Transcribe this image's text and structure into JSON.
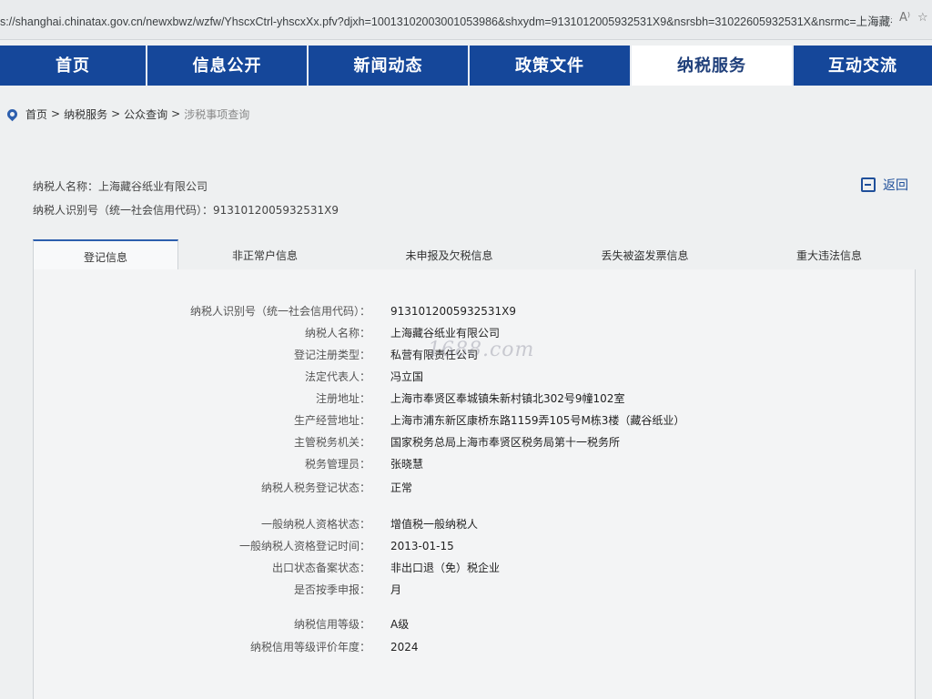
{
  "browser": {
    "url": "s://shanghai.chinatax.gov.cn/newxbwz/wzfw/YhscxCtrl-yhscxXx.pfv?djxh=10013102003001053986&shxydm=9131012005932531X9&nsrsbh=31022605932531X&nsrmc=上海藏谷纸..."
  },
  "nav": {
    "items": [
      {
        "label": "首页"
      },
      {
        "label": "信息公开"
      },
      {
        "label": "新闻动态"
      },
      {
        "label": "政策文件"
      },
      {
        "label": "纳税服务"
      },
      {
        "label": "互动交流"
      }
    ]
  },
  "breadcrumb": {
    "home": "首页",
    "level2": "纳税服务",
    "level3": "公众查询",
    "current": "涉税事项查询",
    "sep": ">"
  },
  "header": {
    "name_line": "纳税人名称：上海藏谷纸业有限公司",
    "id_line": "纳税人识别号（统一社会信用代码）：9131012005932531X9",
    "back_label": "返回"
  },
  "tabs": [
    {
      "label": "登记信息"
    },
    {
      "label": "非正常户信息"
    },
    {
      "label": "未申报及欠税信息"
    },
    {
      "label": "丢失被盗发票信息"
    },
    {
      "label": "重大违法信息"
    }
  ],
  "details": [
    {
      "label": "纳税人识别号（统一社会信用代码）：",
      "value": "9131012005932531X9"
    },
    {
      "label": "纳税人名称：",
      "value": "上海藏谷纸业有限公司"
    },
    {
      "label": "登记注册类型：",
      "value": "私营有限责任公司"
    },
    {
      "label": "法定代表人：",
      "value": "冯立国"
    },
    {
      "label": "注册地址：",
      "value": "上海市奉贤区奉城镇朱新村镇北302号9幢102室"
    },
    {
      "label": "生产经营地址：",
      "value": "上海市浦东新区康桥东路1159弄105号M栋3楼（藏谷纸业）"
    },
    {
      "label": "主管税务机关：",
      "value": "国家税务总局上海市奉贤区税务局第十一税务所"
    },
    {
      "label": "税务管理员：",
      "value": "张晓慧"
    },
    {
      "label": "纳税人税务登记状态：",
      "value": "正常"
    },
    {
      "label": "一般纳税人资格状态：",
      "value": "增值税一般纳税人"
    },
    {
      "label": "一般纳税人资格登记时间：",
      "value": "2013-01-15"
    },
    {
      "label": "出口状态备案状态：",
      "value": "非出口退（免）税企业"
    },
    {
      "label": "是否按季申报：",
      "value": "月"
    },
    {
      "label": "纳税信用等级：",
      "value": "A级"
    },
    {
      "label": "纳税信用等级评价年度：",
      "value": "2024"
    }
  ],
  "watermark": "1688.com"
}
